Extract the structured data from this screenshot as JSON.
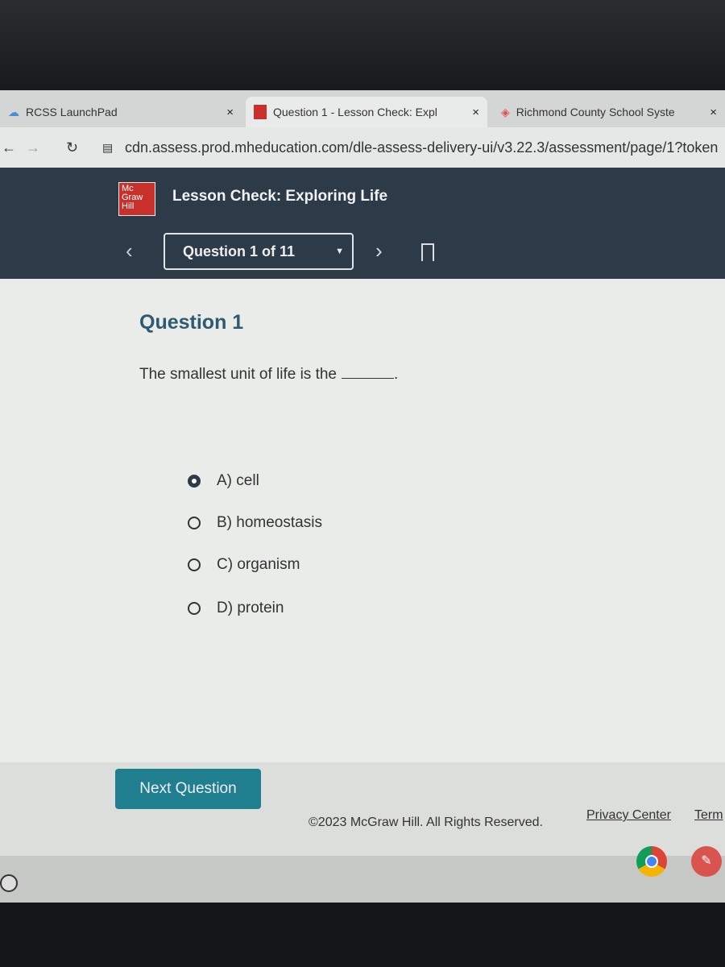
{
  "browser": {
    "tabs": [
      {
        "title": "RCSS LaunchPad",
        "active": false
      },
      {
        "title": "Question 1 - Lesson Check: Expl",
        "active": true
      },
      {
        "title": "Richmond County School Syste",
        "active": false
      }
    ],
    "close_glyph": "×",
    "url": "cdn.assess.prod.mheducation.com/dle-assess-delivery-ui/v3.22.3/assessment/page/1?token"
  },
  "header": {
    "logo_text": "Mc Graw Hill",
    "title": "Lesson Check: Exploring Life",
    "question_selector": "Question 1 of 11"
  },
  "question": {
    "heading": "Question 1",
    "prompt": "The smallest unit of life is the",
    "options": [
      {
        "label": "A) cell",
        "selected": true
      },
      {
        "label": "B) homeostasis",
        "selected": false
      },
      {
        "label": "C) organism",
        "selected": false
      },
      {
        "label": "D) protein",
        "selected": false
      }
    ]
  },
  "footer": {
    "next_button": "Next Question",
    "copyright": "©2023 McGraw Hill. All Rights Reserved.",
    "privacy": "Privacy Center",
    "terms": "Term"
  },
  "colors": {
    "header": "#2d3a48",
    "accent": "#1f7f8f",
    "brand_red": "#c9302c",
    "heading": "#2f5a72"
  }
}
